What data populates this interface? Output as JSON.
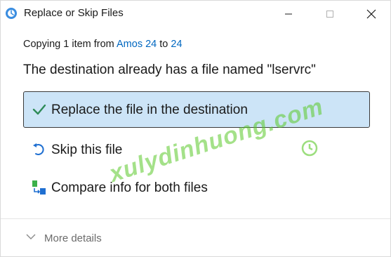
{
  "window": {
    "title": "Replace or Skip Files",
    "controls": {
      "minimize_icon": "minimize-icon",
      "maximize_icon": "maximize-icon",
      "close_icon": "close-icon"
    }
  },
  "copy_info": {
    "prefix": "Copying",
    "count": "1",
    "item_word": "item from",
    "source": "Amos 24",
    "to_word": "to",
    "destination": "24"
  },
  "message": "The destination already has a file named \"lservrc\"",
  "options": [
    {
      "label": "Replace the file in the destination",
      "icon": "checkmark-icon",
      "selected": true
    },
    {
      "label": "Skip this file",
      "icon": "undo-arrow-icon",
      "selected": false
    },
    {
      "label": "Compare info for both files",
      "icon": "compare-files-icon",
      "selected": false
    }
  ],
  "footer": {
    "more_details": "More details",
    "chevron_icon": "chevron-down-icon"
  },
  "watermark": "xulydinhuong.com",
  "colors": {
    "accent": "#0067c0",
    "selection_bg": "#cce4f7",
    "check_green": "#2e8b57",
    "watermark": "#5ac828"
  }
}
